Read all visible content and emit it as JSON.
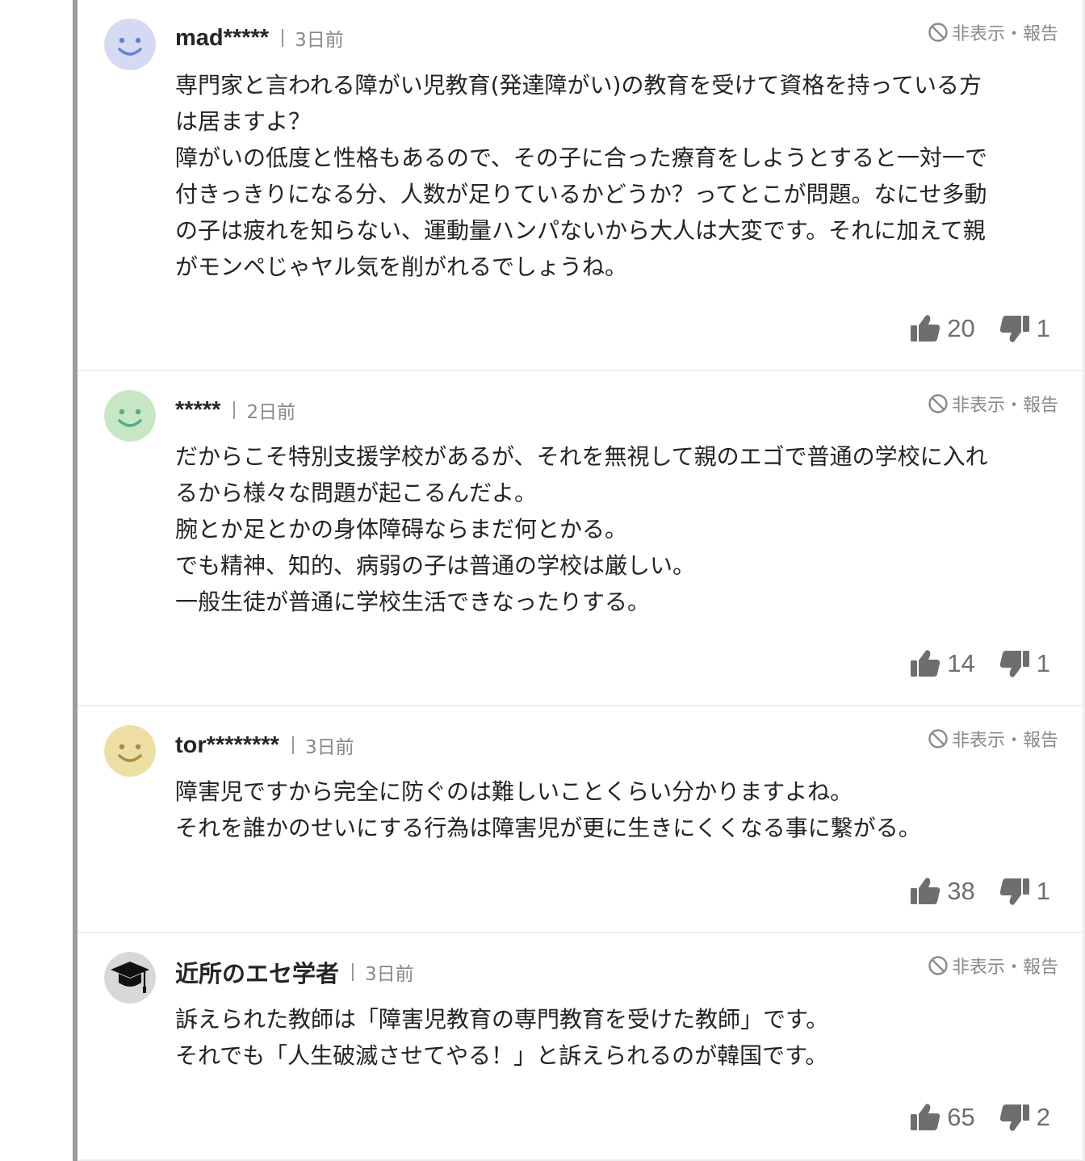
{
  "comments": [
    {
      "author": "mad*****",
      "time": "3日前",
      "action": "非表示・報告",
      "body": "専門家と言われる障がい児教育(発達障がい)の教育を受けて資格を持っている方\nは居ますよ？\n障がいの低度と性格もあるので、その子に合った療育をしようとすると一対一で\n付きっきりになる分、人数が足りているかどうか？ってとこが問題。なにせ多動\nの子は疲れを知らない、運動量ハンパないから大人は大変です。それに加えて親\nがモンペじゃヤル気を削がれるでしょうね。",
      "likes": "20",
      "dislikes": "1",
      "avatar": {
        "type": "smiley",
        "bg": "#d6d9f2",
        "fg": "#5b84d8"
      }
    },
    {
      "author": "*****",
      "time": "2日前",
      "action": "非表示・報告",
      "body": "だからこそ特別支援学校があるが、それを無視して親のエゴで普通の学校に入れ\nるから様々な問題が起こるんだよ。\n腕とか足とかの身体障碍ならまだ何とかる。\nでも精神、知的、病弱の子は普通の学校は厳しい。\n一般生徒が普通に学校生活できなったりする。",
      "likes": "14",
      "dislikes": "1",
      "avatar": {
        "type": "smiley",
        "bg": "#c7e6c4",
        "fg": "#4fae8a"
      }
    },
    {
      "author": "tor********",
      "time": "3日前",
      "action": "非表示・報告",
      "body": "障害児ですから完全に防ぐのは難しいことくらい分かりますよね。\nそれを誰かのせいにする行為は障害児が更に生きにくくなる事に繋がる。",
      "likes": "38",
      "dislikes": "1",
      "avatar": {
        "type": "smiley",
        "bg": "#ecdfa4",
        "fg": "#b08a3c"
      }
    },
    {
      "author": "近所のエセ学者",
      "time": "3日前",
      "action": "非表示・報告",
      "body": "訴えられた教師は「障害児教育の専門教育を受けた教師」です。\nそれでも「人生破滅させてやる！」と訴えられるのが韓国です。",
      "likes": "65",
      "dislikes": "2",
      "avatar": {
        "type": "graduation-cap",
        "bg": "#d8d8d8",
        "fg": "#111111"
      }
    }
  ]
}
